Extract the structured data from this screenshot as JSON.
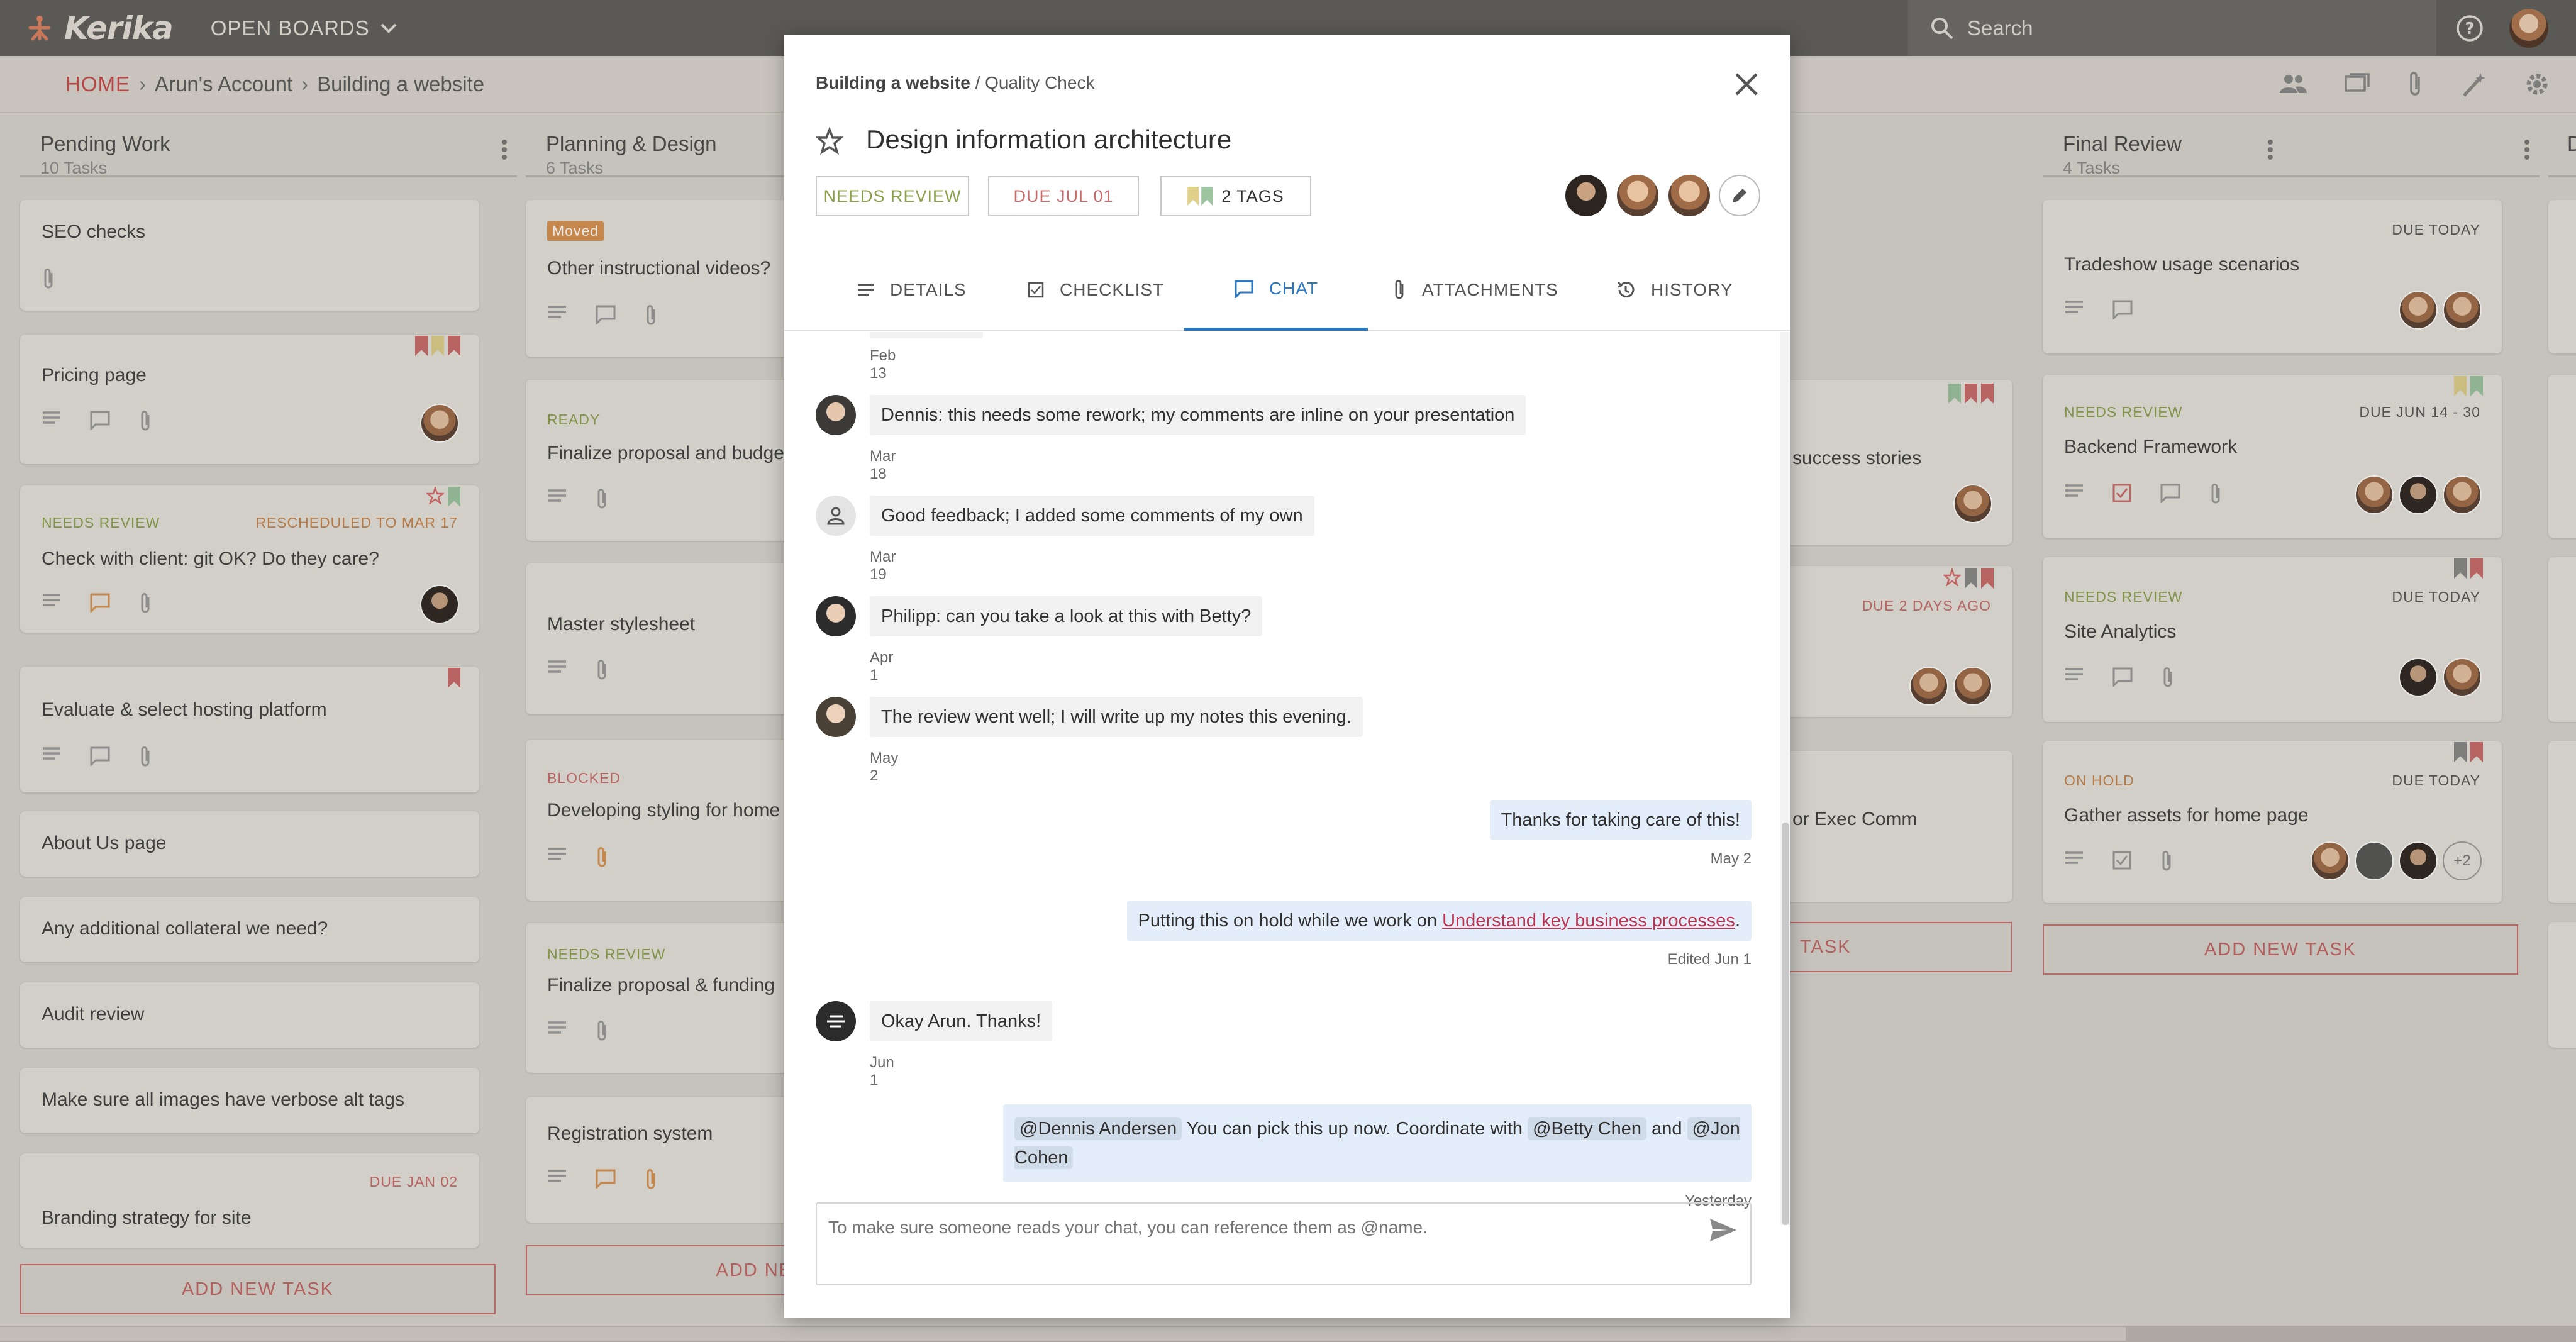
{
  "app": {
    "name": "Kerika",
    "open_boards": "OPEN BOARDS",
    "search_placeholder": "Search"
  },
  "breadcrumb": {
    "home": "HOME",
    "account": "Arun's Account",
    "board": "Building a website"
  },
  "columns": [
    {
      "title": "Pending Work",
      "count": "10 Tasks",
      "cards": [
        {
          "title": "SEO checks"
        },
        {
          "title": "Pricing page"
        },
        {
          "title": "Check with client: git OK? Do they care?",
          "status": "NEEDS REVIEW",
          "due": "RESCHEDULED TO MAR 17"
        },
        {
          "title": "Evaluate & select hosting platform"
        },
        {
          "title": "About Us page"
        },
        {
          "title": "Any additional collateral we need?"
        },
        {
          "title": "Audit review"
        },
        {
          "title": "Make sure all images have verbose alt tags"
        },
        {
          "title": "Branding strategy for site",
          "due": "DUE JAN 02"
        }
      ],
      "add_task": "ADD NEW TASK"
    },
    {
      "title": "Planning & Design",
      "count": "6 Tasks",
      "cards": [
        {
          "title": "Other instructional videos?",
          "status": "Moved"
        },
        {
          "title": "Finalize proposal and budge",
          "status": "READY"
        },
        {
          "title": "Master stylesheet"
        },
        {
          "title": "Developing styling for home",
          "status": "BLOCKED"
        },
        {
          "title": "Finalize proposal & funding",
          "status": "NEEDS REVIEW"
        },
        {
          "title": "Registration system"
        }
      ],
      "add_task": "ADD NEW"
    },
    {
      "cards": [
        {
          "title": "success stories"
        },
        {
          "title": "",
          "due": "DUE 2 DAYS AGO"
        },
        {
          "title": "or Exec Comm"
        }
      ],
      "add_task": "TASK"
    },
    {
      "title": "Final Review",
      "count": "4 Tasks",
      "cards": [
        {
          "title": "Tradeshow usage scenarios",
          "due": "DUE TODAY"
        },
        {
          "title": "Backend Framework",
          "status": "NEEDS REVIEW",
          "due": "DUE JUN 14 - 30"
        },
        {
          "title": "Site Analytics",
          "status": "NEEDS REVIEW",
          "due": "DUE TODAY"
        },
        {
          "title": "Gather assets for home page",
          "status": "ON HOLD",
          "due": "DUE TODAY",
          "more": "+2"
        }
      ],
      "add_task": "ADD NEW TASK"
    },
    {
      "title": "D"
    }
  ],
  "modal": {
    "board": "Building a website",
    "column": "Quality Check",
    "title": "Design information architecture",
    "status": "NEEDS REVIEW",
    "due": "DUE JUL 01",
    "tags": "2 TAGS",
    "tabs": [
      "DETAILS",
      "CHECKLIST",
      "CHAT",
      "ATTACHMENTS",
      "HISTORY"
    ],
    "active_tab": "CHAT",
    "messages": [
      {
        "text": "",
        "when": "Feb 13"
      },
      {
        "text": "Dennis: this needs some rework; my comments are inline on your presentation",
        "when": "Mar 18"
      },
      {
        "text": "Good feedback; I added some comments of my own",
        "when": "Mar 19"
      },
      {
        "text": "Philipp: can you take a look at this with Betty?",
        "when": "Apr 1"
      },
      {
        "text": "The review went well; I will write up my notes this evening.",
        "when": "May 2"
      },
      {
        "text": "Thanks for taking care of this!",
        "when": "May 2"
      },
      {
        "text": "Putting this on hold while we work on",
        "link": "Understand key business processes",
        "tail": ".",
        "when": "Edited Jun 1"
      },
      {
        "text": "Okay Arun. Thanks!",
        "when": "Jun 1"
      },
      {
        "mention1": "@Dennis Andersen",
        "text1": "You can pick this up now. Coordinate with",
        "mention2": "@Betty Chen",
        "text2": "and",
        "mention3": "@Jon Cohen",
        "when": "Yesterday"
      }
    ],
    "compose_placeholder": "To make sure someone reads your chat, you can reference them as @name."
  },
  "colors": {
    "accent": "#2b78c0",
    "danger": "#c54b4b",
    "review": "#8aa04a",
    "hold": "#c8844a"
  }
}
